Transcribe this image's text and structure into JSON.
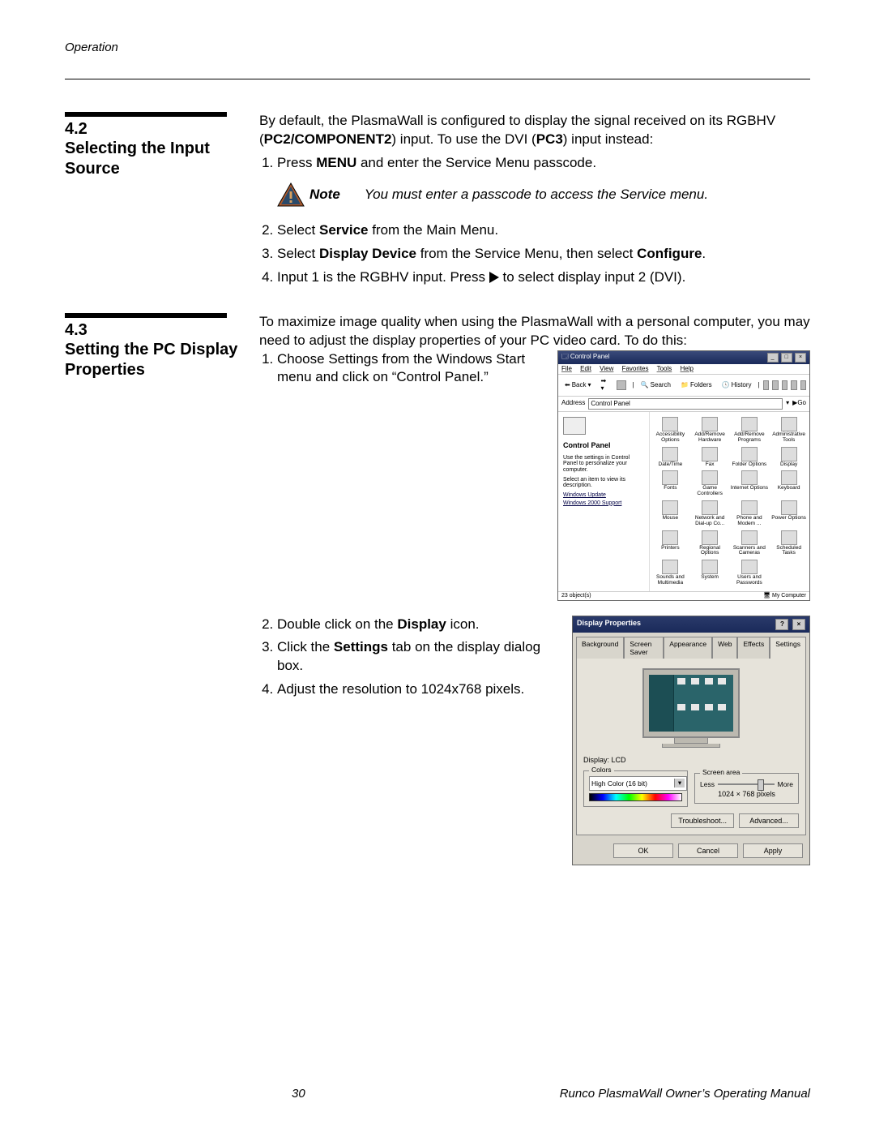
{
  "header": {
    "section_label": "Operation"
  },
  "section42": {
    "number": "4.2",
    "title": "Selecting the Input Source",
    "intro_pre": "By default, the PlasmaWall is configured to display the signal received on its RGBHV (",
    "intro_bold1": "PC2/COMPONENT2",
    "intro_mid": ") input. To use the DVI (",
    "intro_bold2": "PC3",
    "intro_post": ") input instead:",
    "step1_pre": "Press ",
    "step1_bold": "MENU",
    "step1_post": " and enter the Service Menu passcode.",
    "note_label": "Note",
    "note_text": "You must enter a passcode to access the Service menu.",
    "step2_pre": "Select ",
    "step2_bold": "Service",
    "step2_post": " from the Main Menu.",
    "step3_pre": "Select ",
    "step3_bold1": "Display Device",
    "step3_mid": " from the Service Menu, then select ",
    "step3_bold2": "Configure",
    "step3_post": ".",
    "step4_pre": "Input 1 is the RGBHV input. Press ",
    "step4_post": " to select display input 2 (DVI)."
  },
  "section43": {
    "number": "4.3",
    "title": "Setting the PC Display Properties",
    "intro": "To maximize image quality when using the PlasmaWall with a personal computer, you may need to adjust the display properties of your PC video card. To do this:",
    "step1": "Choose Settings from the Windows Start menu and click on “Control Panel.”",
    "step2_pre": "Double click on the ",
    "step2_bold": "Display",
    "step2_post": " icon.",
    "step3_pre": "Click the ",
    "step3_bold": "Settings",
    "step3_post": " tab on the display dialog box.",
    "step4": "Adjust the resolution to 1024x768 pixels."
  },
  "control_panel": {
    "title": "Control Panel",
    "menu": [
      "File",
      "Edit",
      "View",
      "Favorites",
      "Tools",
      "Help"
    ],
    "toolbar": {
      "back": "Back",
      "search": "Search",
      "folders": "Folders",
      "history": "History"
    },
    "address_label": "Address",
    "address_value": "Control Panel",
    "go": "Go",
    "side_title": "Control Panel",
    "side_desc1": "Use the settings in Control Panel to personalize your computer.",
    "side_desc2": "Select an item to view its description.",
    "side_links": [
      "Windows Update",
      "Windows 2000 Support"
    ],
    "icons": [
      "Accessibility Options",
      "Add/Remove Hardware",
      "Add/Remove Programs",
      "Administrative Tools",
      "Date/Time",
      "Fax",
      "Folder Options",
      "Display",
      "Fonts",
      "Game Controllers",
      "Internet Options",
      "Keyboard",
      "Mouse",
      "Network and Dial-up Co...",
      "Phone and Modem ...",
      "Power Options",
      "Printers",
      "Regional Options",
      "Scanners and Cameras",
      "Scheduled Tasks",
      "Sounds and Multimedia",
      "System",
      "Users and Passwords"
    ],
    "status_left": "23 object(s)",
    "status_right": "My Computer"
  },
  "display_props": {
    "title": "Display Properties",
    "tabs": [
      "Background",
      "Screen Saver",
      "Appearance",
      "Web",
      "Effects",
      "Settings"
    ],
    "display_label": "Display:",
    "display_value": "LCD",
    "colors_legend": "Colors",
    "colors_value": "High Color (16 bit)",
    "screen_legend": "Screen area",
    "less": "Less",
    "more": "More",
    "resolution": "1024 × 768 pixels",
    "troubleshoot": "Troubleshoot...",
    "advanced": "Advanced...",
    "ok": "OK",
    "cancel": "Cancel",
    "apply": "Apply"
  },
  "footer": {
    "page_number": "30",
    "title": "Runco PlasmaWall Owner’s Operating Manual"
  }
}
